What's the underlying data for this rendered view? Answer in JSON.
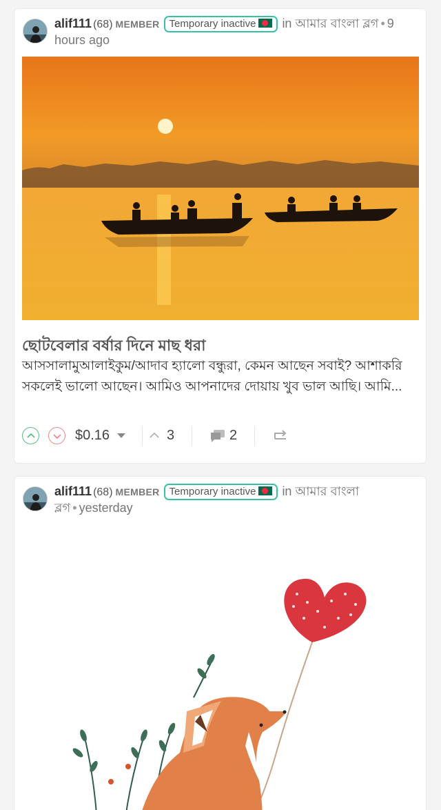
{
  "posts": [
    {
      "author": "alif111",
      "reputation": "(68)",
      "role": "MEMBER",
      "badge": "Temporary inactive",
      "in_label": "in",
      "community": "আমার বাংলা ব্লগ",
      "time": "9 hours ago",
      "title": "ছোটবেলার বর্ষার দিনে মাছ ধরা",
      "body": "আসসালামুআলাইকুম/আদাব হ্যালো বন্ধুরা, কেমন আছেন সবাই? আশাকরি সকলেই ভালো আছেন। আমিও আপনাদের দোয়ায় খুব ভাল আছি। আমি...",
      "payout": "$0.16",
      "votes": "3",
      "comments": "2",
      "image_icon": "sunset-boats-image"
    },
    {
      "author": "alif111",
      "reputation": "(68)",
      "role": "MEMBER",
      "badge": "Temporary inactive",
      "in_label": "in",
      "community": "আমার বাংলা ব্লগ",
      "time": "yesterday",
      "image_icon": "fox-heart-balloon-image"
    }
  ],
  "colors": {
    "badge_border": "#3ac0a8",
    "upvote": "#5ac07c",
    "downvote": "#ef8a8a",
    "flag_green": "#006a4e",
    "flag_red": "#f42a41"
  }
}
